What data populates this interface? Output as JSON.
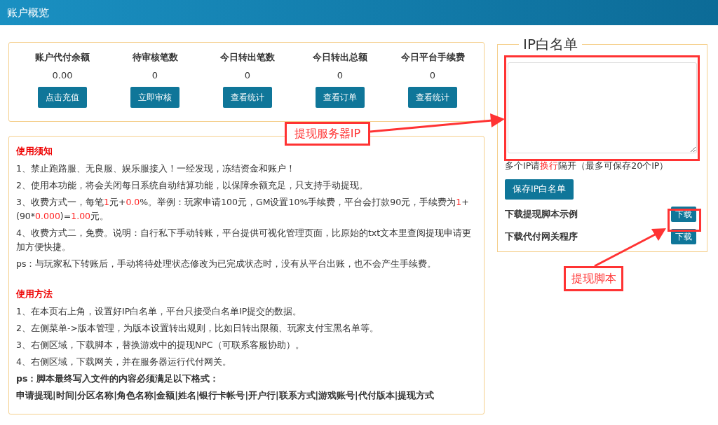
{
  "header": {
    "title": "账户概览"
  },
  "stats": [
    {
      "label": "账户代付余额",
      "value": "0.00",
      "button": "点击充值"
    },
    {
      "label": "待审核笔数",
      "value": "0",
      "button": "立即审核"
    },
    {
      "label": "今日转出笔数",
      "value": "0",
      "button": "查看统计"
    },
    {
      "label": "今日转出总额",
      "value": "0",
      "button": "查看订单"
    },
    {
      "label": "今日平台手续费",
      "value": "0",
      "button": "查看统计"
    }
  ],
  "notice": {
    "sections": [
      {
        "title": "使用须知",
        "lines": [
          {
            "kind": "plain",
            "parts": [
              {
                "text": "1、禁止跑路服、无良服、娱乐服接入！一经发现，冻结资金和账户！",
                "highlight": false
              }
            ]
          },
          {
            "kind": "plain",
            "parts": [
              {
                "text": "2、使用本功能，将会关闭每日系统自动结算功能，以保障余额充足，只支持手动提现。",
                "highlight": false
              }
            ]
          },
          {
            "kind": "plain",
            "parts": [
              {
                "text": "3、收费方式一，每笔",
                "highlight": false
              },
              {
                "text": "1",
                "highlight": true
              },
              {
                "text": "元+",
                "highlight": false
              },
              {
                "text": "0.0",
                "highlight": true
              },
              {
                "text": "%。举例：玩家申请100元，GM设置10%手续费，平台会打款90元，手续费为",
                "highlight": false
              },
              {
                "text": "1",
                "highlight": true
              },
              {
                "text": "+(90*",
                "highlight": false
              },
              {
                "text": "0.000",
                "highlight": true
              },
              {
                "text": ")=",
                "highlight": false
              },
              {
                "text": "1.00",
                "highlight": true
              },
              {
                "text": "元。",
                "highlight": false
              }
            ]
          },
          {
            "kind": "plain",
            "parts": [
              {
                "text": "4、收费方式二，免费。说明：自行私下手动转账，平台提供可视化管理页面，比原始的txt文本里查阅提现申请更加方便快捷。",
                "highlight": false
              }
            ]
          },
          {
            "kind": "plain",
            "parts": [
              {
                "text": "ps：与玩家私下转账后，手动将待处理状态修改为已完成状态时，没有从平台出账，也不会产生手续费。",
                "highlight": false
              }
            ]
          }
        ]
      },
      {
        "title": "使用方法",
        "lines": [
          {
            "kind": "plain",
            "parts": [
              {
                "text": "1、在本页右上角，设置好IP白名单，平台只接受白名单IP提交的数据。",
                "highlight": false
              }
            ]
          },
          {
            "kind": "plain",
            "parts": [
              {
                "text": "2、左侧菜单->版本管理，为版本设置转出规则，比如日转出限额、玩家支付宝黑名单等。",
                "highlight": false
              }
            ]
          },
          {
            "kind": "plain",
            "parts": [
              {
                "text": "3、右侧区域，下载脚本，替换游戏中的提现NPC（可联系客服协助）。",
                "highlight": false
              }
            ]
          },
          {
            "kind": "plain",
            "parts": [
              {
                "text": "4、右侧区域，下载网关，并在服务器运行代付网关。",
                "highlight": false
              }
            ]
          },
          {
            "kind": "bold",
            "parts": [
              {
                "text": "ps：脚本最终写入文件的内容必须满足以下格式：",
                "highlight": false
              }
            ]
          },
          {
            "kind": "bold",
            "parts": [
              {
                "text": "申请提现|时间|分区名称|角色名称|金额|姓名|银行卡帐号|开户行|联系方式|游戏账号|代付版本|提现方式",
                "highlight": false
              }
            ]
          }
        ]
      }
    ]
  },
  "whitelist": {
    "legend": "IP白名单",
    "hint": [
      {
        "text": "多个IP请",
        "highlight": false
      },
      {
        "text": "换行",
        "highlight": true
      },
      {
        "text": "隔开（最多可保存20个IP）",
        "highlight": false
      }
    ],
    "save_button": "保存IP白名单",
    "downloads": [
      {
        "label": "下载提现脚本示例",
        "button": "下载"
      },
      {
        "label": "下载代付网关程序",
        "button": "下载"
      }
    ]
  },
  "annotations": [
    {
      "text": "提现服务器IP"
    },
    {
      "text": "提现脚本"
    }
  ]
}
